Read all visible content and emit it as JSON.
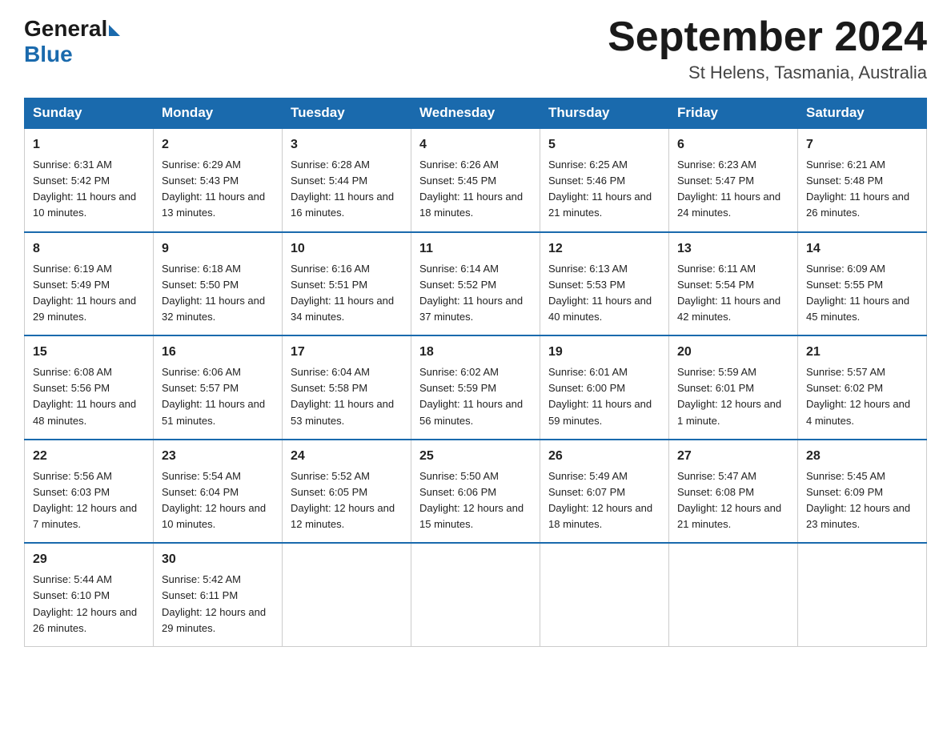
{
  "header": {
    "logo_general": "General",
    "logo_blue": "Blue",
    "month_year": "September 2024",
    "location": "St Helens, Tasmania, Australia"
  },
  "weekdays": [
    "Sunday",
    "Monday",
    "Tuesday",
    "Wednesday",
    "Thursday",
    "Friday",
    "Saturday"
  ],
  "weeks": [
    [
      {
        "day": "1",
        "sunrise": "6:31 AM",
        "sunset": "5:42 PM",
        "daylight": "11 hours and 10 minutes."
      },
      {
        "day": "2",
        "sunrise": "6:29 AM",
        "sunset": "5:43 PM",
        "daylight": "11 hours and 13 minutes."
      },
      {
        "day": "3",
        "sunrise": "6:28 AM",
        "sunset": "5:44 PM",
        "daylight": "11 hours and 16 minutes."
      },
      {
        "day": "4",
        "sunrise": "6:26 AM",
        "sunset": "5:45 PM",
        "daylight": "11 hours and 18 minutes."
      },
      {
        "day": "5",
        "sunrise": "6:25 AM",
        "sunset": "5:46 PM",
        "daylight": "11 hours and 21 minutes."
      },
      {
        "day": "6",
        "sunrise": "6:23 AM",
        "sunset": "5:47 PM",
        "daylight": "11 hours and 24 minutes."
      },
      {
        "day": "7",
        "sunrise": "6:21 AM",
        "sunset": "5:48 PM",
        "daylight": "11 hours and 26 minutes."
      }
    ],
    [
      {
        "day": "8",
        "sunrise": "6:19 AM",
        "sunset": "5:49 PM",
        "daylight": "11 hours and 29 minutes."
      },
      {
        "day": "9",
        "sunrise": "6:18 AM",
        "sunset": "5:50 PM",
        "daylight": "11 hours and 32 minutes."
      },
      {
        "day": "10",
        "sunrise": "6:16 AM",
        "sunset": "5:51 PM",
        "daylight": "11 hours and 34 minutes."
      },
      {
        "day": "11",
        "sunrise": "6:14 AM",
        "sunset": "5:52 PM",
        "daylight": "11 hours and 37 minutes."
      },
      {
        "day": "12",
        "sunrise": "6:13 AM",
        "sunset": "5:53 PM",
        "daylight": "11 hours and 40 minutes."
      },
      {
        "day": "13",
        "sunrise": "6:11 AM",
        "sunset": "5:54 PM",
        "daylight": "11 hours and 42 minutes."
      },
      {
        "day": "14",
        "sunrise": "6:09 AM",
        "sunset": "5:55 PM",
        "daylight": "11 hours and 45 minutes."
      }
    ],
    [
      {
        "day": "15",
        "sunrise": "6:08 AM",
        "sunset": "5:56 PM",
        "daylight": "11 hours and 48 minutes."
      },
      {
        "day": "16",
        "sunrise": "6:06 AM",
        "sunset": "5:57 PM",
        "daylight": "11 hours and 51 minutes."
      },
      {
        "day": "17",
        "sunrise": "6:04 AM",
        "sunset": "5:58 PM",
        "daylight": "11 hours and 53 minutes."
      },
      {
        "day": "18",
        "sunrise": "6:02 AM",
        "sunset": "5:59 PM",
        "daylight": "11 hours and 56 minutes."
      },
      {
        "day": "19",
        "sunrise": "6:01 AM",
        "sunset": "6:00 PM",
        "daylight": "11 hours and 59 minutes."
      },
      {
        "day": "20",
        "sunrise": "5:59 AM",
        "sunset": "6:01 PM",
        "daylight": "12 hours and 1 minute."
      },
      {
        "day": "21",
        "sunrise": "5:57 AM",
        "sunset": "6:02 PM",
        "daylight": "12 hours and 4 minutes."
      }
    ],
    [
      {
        "day": "22",
        "sunrise": "5:56 AM",
        "sunset": "6:03 PM",
        "daylight": "12 hours and 7 minutes."
      },
      {
        "day": "23",
        "sunrise": "5:54 AM",
        "sunset": "6:04 PM",
        "daylight": "12 hours and 10 minutes."
      },
      {
        "day": "24",
        "sunrise": "5:52 AM",
        "sunset": "6:05 PM",
        "daylight": "12 hours and 12 minutes."
      },
      {
        "day": "25",
        "sunrise": "5:50 AM",
        "sunset": "6:06 PM",
        "daylight": "12 hours and 15 minutes."
      },
      {
        "day": "26",
        "sunrise": "5:49 AM",
        "sunset": "6:07 PM",
        "daylight": "12 hours and 18 minutes."
      },
      {
        "day": "27",
        "sunrise": "5:47 AM",
        "sunset": "6:08 PM",
        "daylight": "12 hours and 21 minutes."
      },
      {
        "day": "28",
        "sunrise": "5:45 AM",
        "sunset": "6:09 PM",
        "daylight": "12 hours and 23 minutes."
      }
    ],
    [
      {
        "day": "29",
        "sunrise": "5:44 AM",
        "sunset": "6:10 PM",
        "daylight": "12 hours and 26 minutes."
      },
      {
        "day": "30",
        "sunrise": "5:42 AM",
        "sunset": "6:11 PM",
        "daylight": "12 hours and 29 minutes."
      },
      null,
      null,
      null,
      null,
      null
    ]
  ],
  "labels": {
    "sunrise": "Sunrise: ",
    "sunset": "Sunset: ",
    "daylight": "Daylight: "
  }
}
